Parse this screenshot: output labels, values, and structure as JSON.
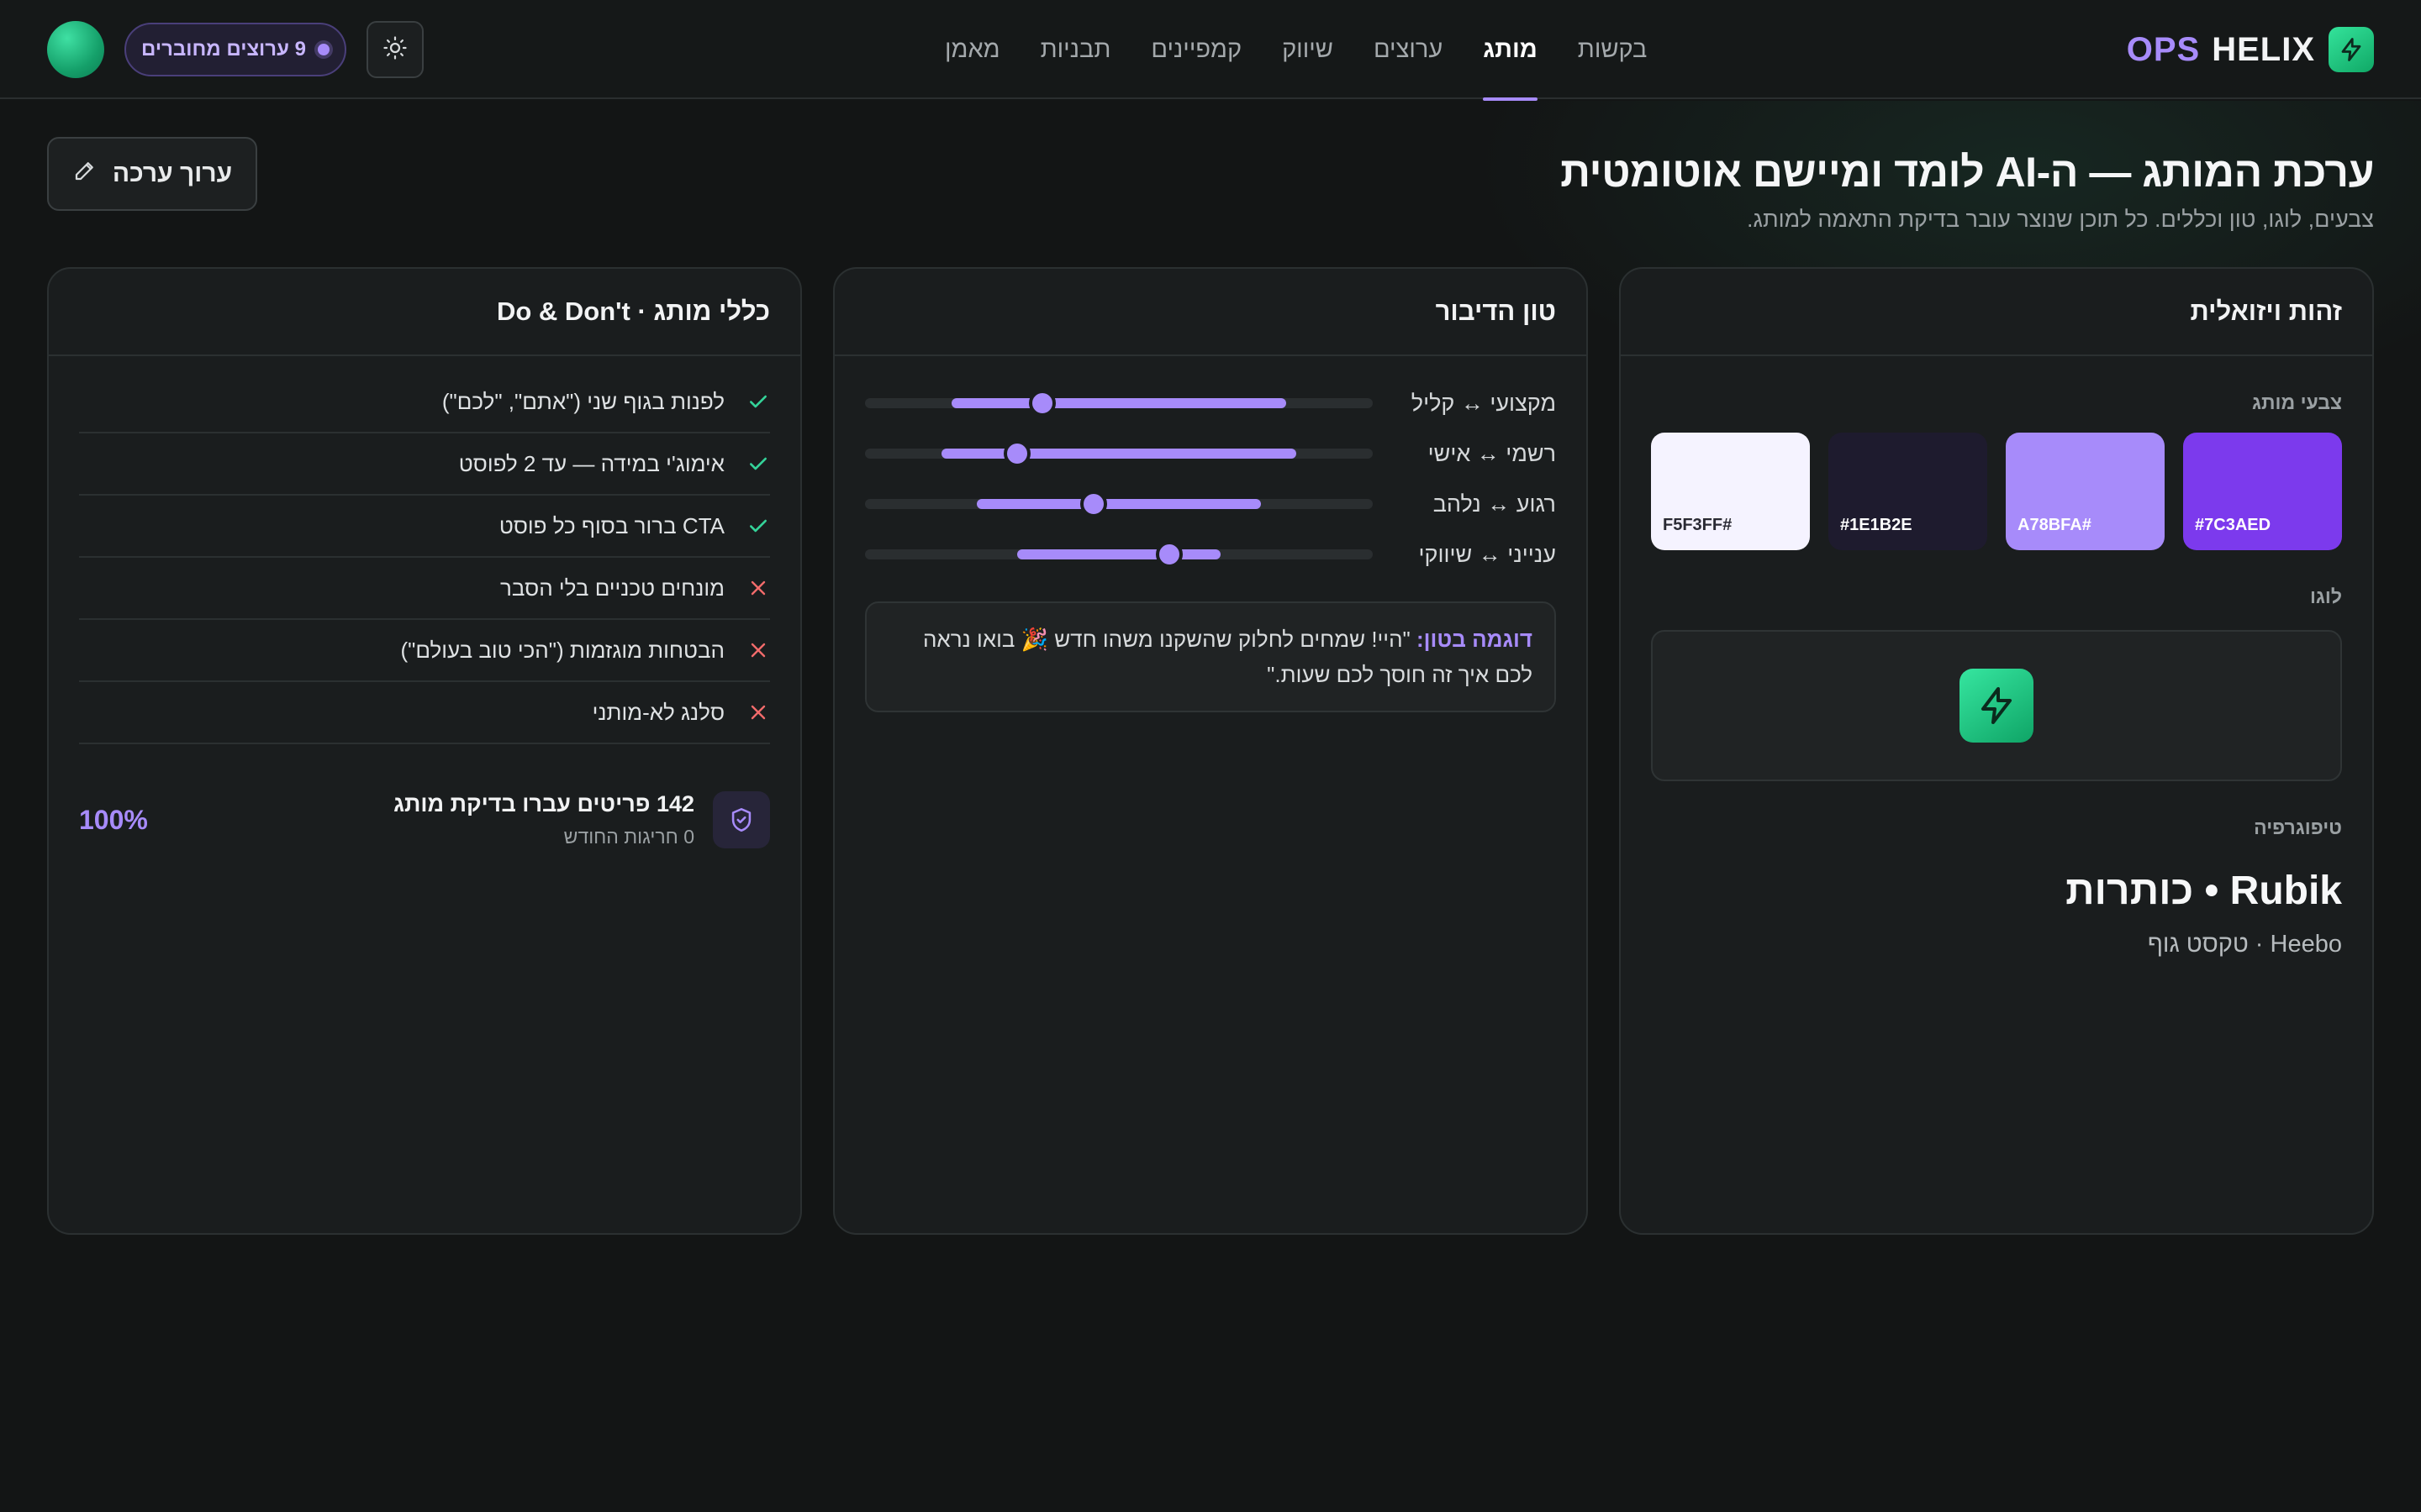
{
  "brand": {
    "part1": "OPS",
    "part2": "HELIX"
  },
  "nav": [
    {
      "label": "בקשות",
      "active": false
    },
    {
      "label": "מותג",
      "active": true
    },
    {
      "label": "ערוצים",
      "active": false
    },
    {
      "label": "שיווק",
      "active": false
    },
    {
      "label": "קמפיינים",
      "active": false
    },
    {
      "label": "תבניות",
      "active": false
    },
    {
      "label": "מאמן",
      "active": false
    }
  ],
  "header": {
    "channels_pill": "9 ערוצים מחוברים"
  },
  "page": {
    "title": "ערכת המותג — ה-AI לומד ומיישם אוטומטית",
    "subtitle": "צבעים, לוגו, טון וכללים. כל תוכן שנוצר עובר בדיקת התאמה למותג.",
    "edit_label": "ערוך ערכה"
  },
  "visual": {
    "title": "זהות ויזואלית",
    "colors_label": "צבעי מותג",
    "colors": [
      {
        "code": "#7C3AED",
        "hex": "#7c3aed",
        "text": "#ffffff"
      },
      {
        "code": "A78BFA#",
        "hex": "#a78bfa",
        "text": "#ffffff"
      },
      {
        "code": "#1E1B2E",
        "hex": "#1e1b2e",
        "text": "#ffffff"
      },
      {
        "code": "F5F3FF#",
        "hex": "#f5f3ff",
        "text": "#2a2a33"
      }
    ],
    "logo_label": "לוגו",
    "typography_label": "טיפוגרפיה",
    "heading_font": "Rubik • כותרות",
    "body_font": "Heebo · טקסט גוף"
  },
  "tone": {
    "title": "טון הדיבור",
    "sliders": [
      {
        "label": "מקצועי ↔ קליל",
        "from": 0.17,
        "to": 0.83,
        "value": 0.35
      },
      {
        "label": "רשמי ↔ אישי",
        "from": 0.15,
        "to": 0.85,
        "value": 0.3
      },
      {
        "label": "רגוע ↔ נלהב",
        "from": 0.22,
        "to": 0.78,
        "value": 0.45
      },
      {
        "label": "ענייני ↔ שיווקי",
        "from": 0.3,
        "to": 0.7,
        "value": 0.6
      }
    ],
    "example_label": "דוגמה בטון:",
    "example_text": " \"היי! שמחים לחלוק שהשקנו משהו חדש 🎉 בואו נראה לכם איך זה חוסך לכם שעות.\""
  },
  "rules": {
    "title": "כללי מותג · Do & Don't",
    "items": [
      {
        "text": "לפנות בגוף שני (\"אתם\", \"לכם\")",
        "ok": true
      },
      {
        "text": "אימוג'י במידה — עד 2 לפוסט",
        "ok": true
      },
      {
        "text": "CTA ברור בסוף כל פוסט",
        "ok": true
      },
      {
        "text": "מונחים טכניים בלי הסבר",
        "ok": false
      },
      {
        "text": "הבטחות מוגזמות (\"הכי טוב בעולם\")",
        "ok": false
      },
      {
        "text": "סלנג לא-מותני",
        "ok": false
      }
    ],
    "summary_title": "142 פריטים עברו בדיקת מותג",
    "summary_sub": "0 חריגות החודש",
    "summary_pct": "100%"
  },
  "colors": {
    "accent": "#a78bfa",
    "ok": "#34d399",
    "bad": "#f26b6b",
    "bg": "#131515"
  },
  "icons": {
    "logo": "bolt-icon",
    "theme": "sun-icon",
    "edit": "pencil-icon",
    "summary": "shield-check-icon",
    "ok": "check-icon",
    "bad": "x-icon"
  }
}
